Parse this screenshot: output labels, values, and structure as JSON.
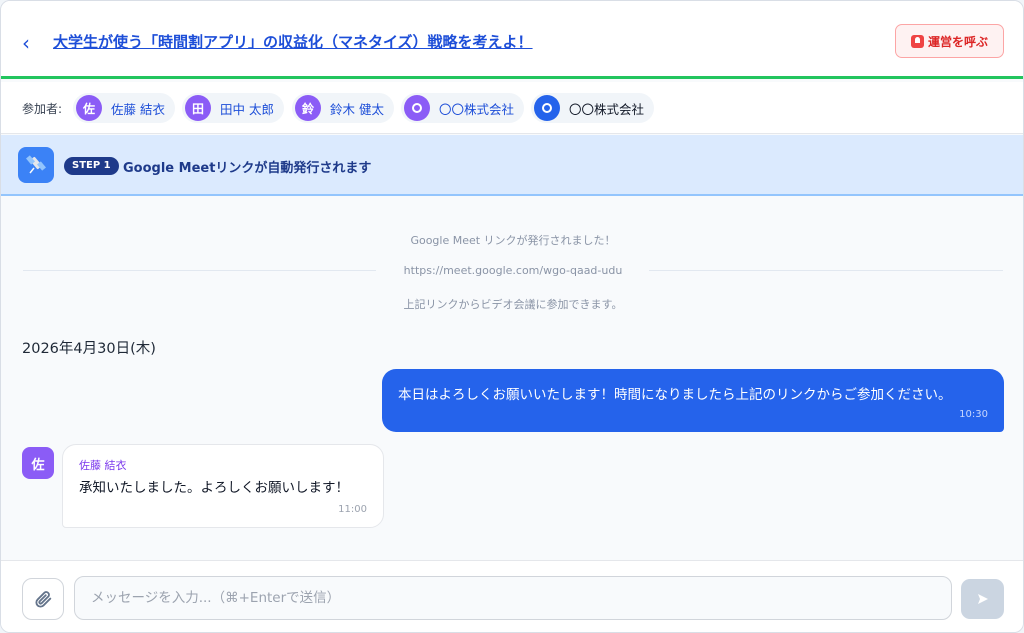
{
  "header": {
    "back_icon": "chevron-left-icon",
    "title": "大学生が使う「時間割アプリ」の収益化（マネタイズ）戦略を考えよ！",
    "call_button": {
      "icon": "siren-icon",
      "label": "運営を呼ぶ"
    }
  },
  "participants": {
    "label": "参加者:",
    "items": [
      {
        "initial": "佐",
        "name": "佐藤 結衣",
        "color": "#8b5cf6"
      },
      {
        "initial": "田",
        "name": "田中 太郎",
        "color": "#8b5cf6"
      },
      {
        "initial": "鈴",
        "name": "鈴木 健太",
        "color": "#8b5cf6"
      },
      {
        "initial": "",
        "name": "〇〇株式会社",
        "color": "#8b5cf6"
      },
      {
        "initial": "",
        "name": "〇〇株式会社",
        "color": "#2563eb"
      }
    ]
  },
  "step": {
    "icon": "satellite-icon",
    "badge": "STEP 1",
    "text": "Google Meetリンクが自動発行されます"
  },
  "system_message": {
    "line1": "Google Meet リンクが発行されました！",
    "link": "https://meet.google.com/wgo-qaad-udu",
    "line3": "上記リンクからビデオ会議に参加できます。"
  },
  "date_label": "2026年4月30日(木)",
  "messages": {
    "outgoing": {
      "text": "本日はよろしくお願いいたします！時間になりましたら上記のリンクからご参加ください。",
      "time": "10:30"
    },
    "incoming": {
      "avatar": "佐",
      "sender": "佐藤 結衣",
      "text": "承知いたしました。よろしくお願いします！",
      "time": "11:00"
    }
  },
  "composer": {
    "attach_icon": "paperclip-icon",
    "placeholder": "メッセージを入力...（⌘+Enterで送信）",
    "value": "",
    "send_icon": "send-icon"
  },
  "colors": {
    "accent": "#2563eb",
    "progress_bar": "#22c55e",
    "step_bg": "#dbeafe",
    "danger": "#dc2626"
  }
}
